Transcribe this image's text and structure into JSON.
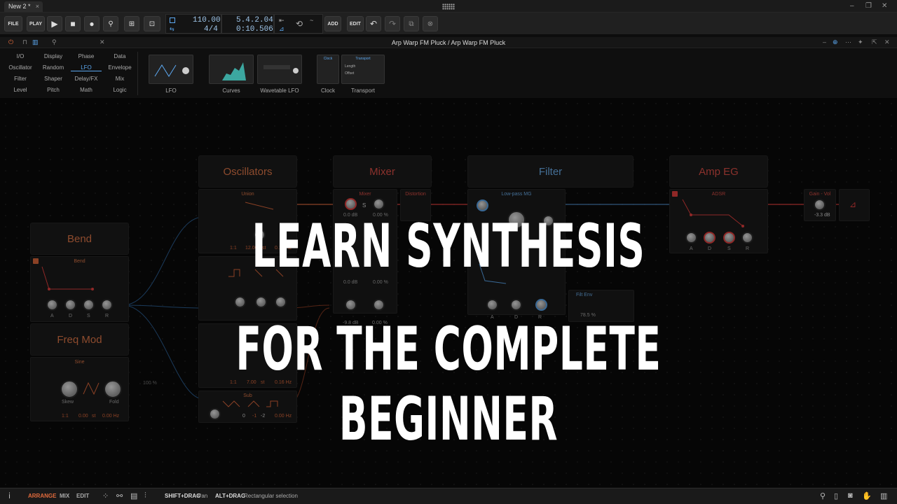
{
  "app": {
    "tab_title": "New 2 *",
    "tab_close": "×"
  },
  "toolbar": {
    "file": "FILE",
    "play_menu": "PLAY",
    "add": "ADD",
    "edit": "EDIT",
    "tempo": "110.00",
    "signature": "4/4",
    "position_bars": "5.4.2.04",
    "position_time": "0:10.506"
  },
  "editor": {
    "title": "Arp Warp FM Pluck / Arp Warp FM Pluck"
  },
  "palette": {
    "categories": [
      [
        "I/O",
        "Display",
        "Phase",
        "Data"
      ],
      [
        "Oscillator",
        "Random",
        "LFO",
        "Envelope"
      ],
      [
        "Filter",
        "Shaper",
        "Delay/FX",
        "Mix"
      ],
      [
        "Level",
        "Pitch",
        "Math",
        "Logic"
      ]
    ],
    "selected": "LFO",
    "devices": [
      "LFO",
      "Curves",
      "Wavetable LFO",
      "Clock",
      "Transport"
    ],
    "transport_thumb": {
      "title": "Transport",
      "length": "Length",
      "offset": "Offset"
    },
    "clock_thumb": {
      "title": "Clock"
    }
  },
  "groups": {
    "bend": "Bend",
    "freq_mod": "Freq Mod",
    "oscillators": "Oscillators",
    "mixer": "Mixer",
    "filter": "Filter",
    "amp_eg": "Amp EG"
  },
  "modules": {
    "bend_env": "Bend",
    "sine": "Sine",
    "union": "Union",
    "sub": "Sub",
    "mixer": "Mixer",
    "distortion": "Distortion",
    "lowpass": "Low-pass MG",
    "adsr": "ADSR",
    "gain": "Gain - Vol",
    "gain_value": "-3.3 dB",
    "mixer_db": "0.0 dB",
    "mixer_pct": "0.00 %",
    "mixer_db2": "0.0 dB",
    "mixer_pct2": "0.00 %",
    "mixer_db3": "-9.8 dB",
    "mixer_pct3": "0.00 %",
    "filter_env": "Filt Env",
    "filter_env_pct": "78.5 %",
    "freq_pct": "100 %",
    "sine_skew": "Skew",
    "sine_fold": "Fold",
    "sine_ratio": "1:1",
    "sine_st": "0.00",
    "sine_st_unit": "st",
    "sine_hz": "0.00 Hz",
    "osc_ratio1": "1:1",
    "osc_st1": "12.00",
    "osc_st_unit": "st",
    "osc_hz1": "0.16 Hz",
    "osc_ratio2": "1:1",
    "osc_st2": "7.00",
    "osc_hz2": "0.16 Hz",
    "sub_vals": [
      "0",
      "-1",
      "-2"
    ],
    "sub_hz": "0.00 Hz",
    "adsr_labels": [
      "A",
      "D",
      "S",
      "R"
    ],
    "bend_labels": [
      "A",
      "D",
      "S",
      "R"
    ],
    "pluck_labels": [
      "A",
      "D",
      "R"
    ]
  },
  "overlay": {
    "line1": "LEARN SYNTHESIS",
    "line2": "FOR THE COMPLETE BEGINNER"
  },
  "statusbar": {
    "arrange": "ARRANGE",
    "mix": "MIX",
    "edit": "EDIT",
    "hint1_key": "SHIFT+DRAG",
    "hint1_text": "Pan",
    "hint2_key": "ALT+DRAG",
    "hint2_text": "Rectangular selection"
  },
  "colors": {
    "accent_orange": "#e06a3c",
    "accent_red": "#e8413f",
    "accent_blue": "#5ca8f0",
    "group_text_orange": "#e47a4a",
    "group_text_red": "#e05048",
    "group_text_blue": "#6fb3f2"
  }
}
